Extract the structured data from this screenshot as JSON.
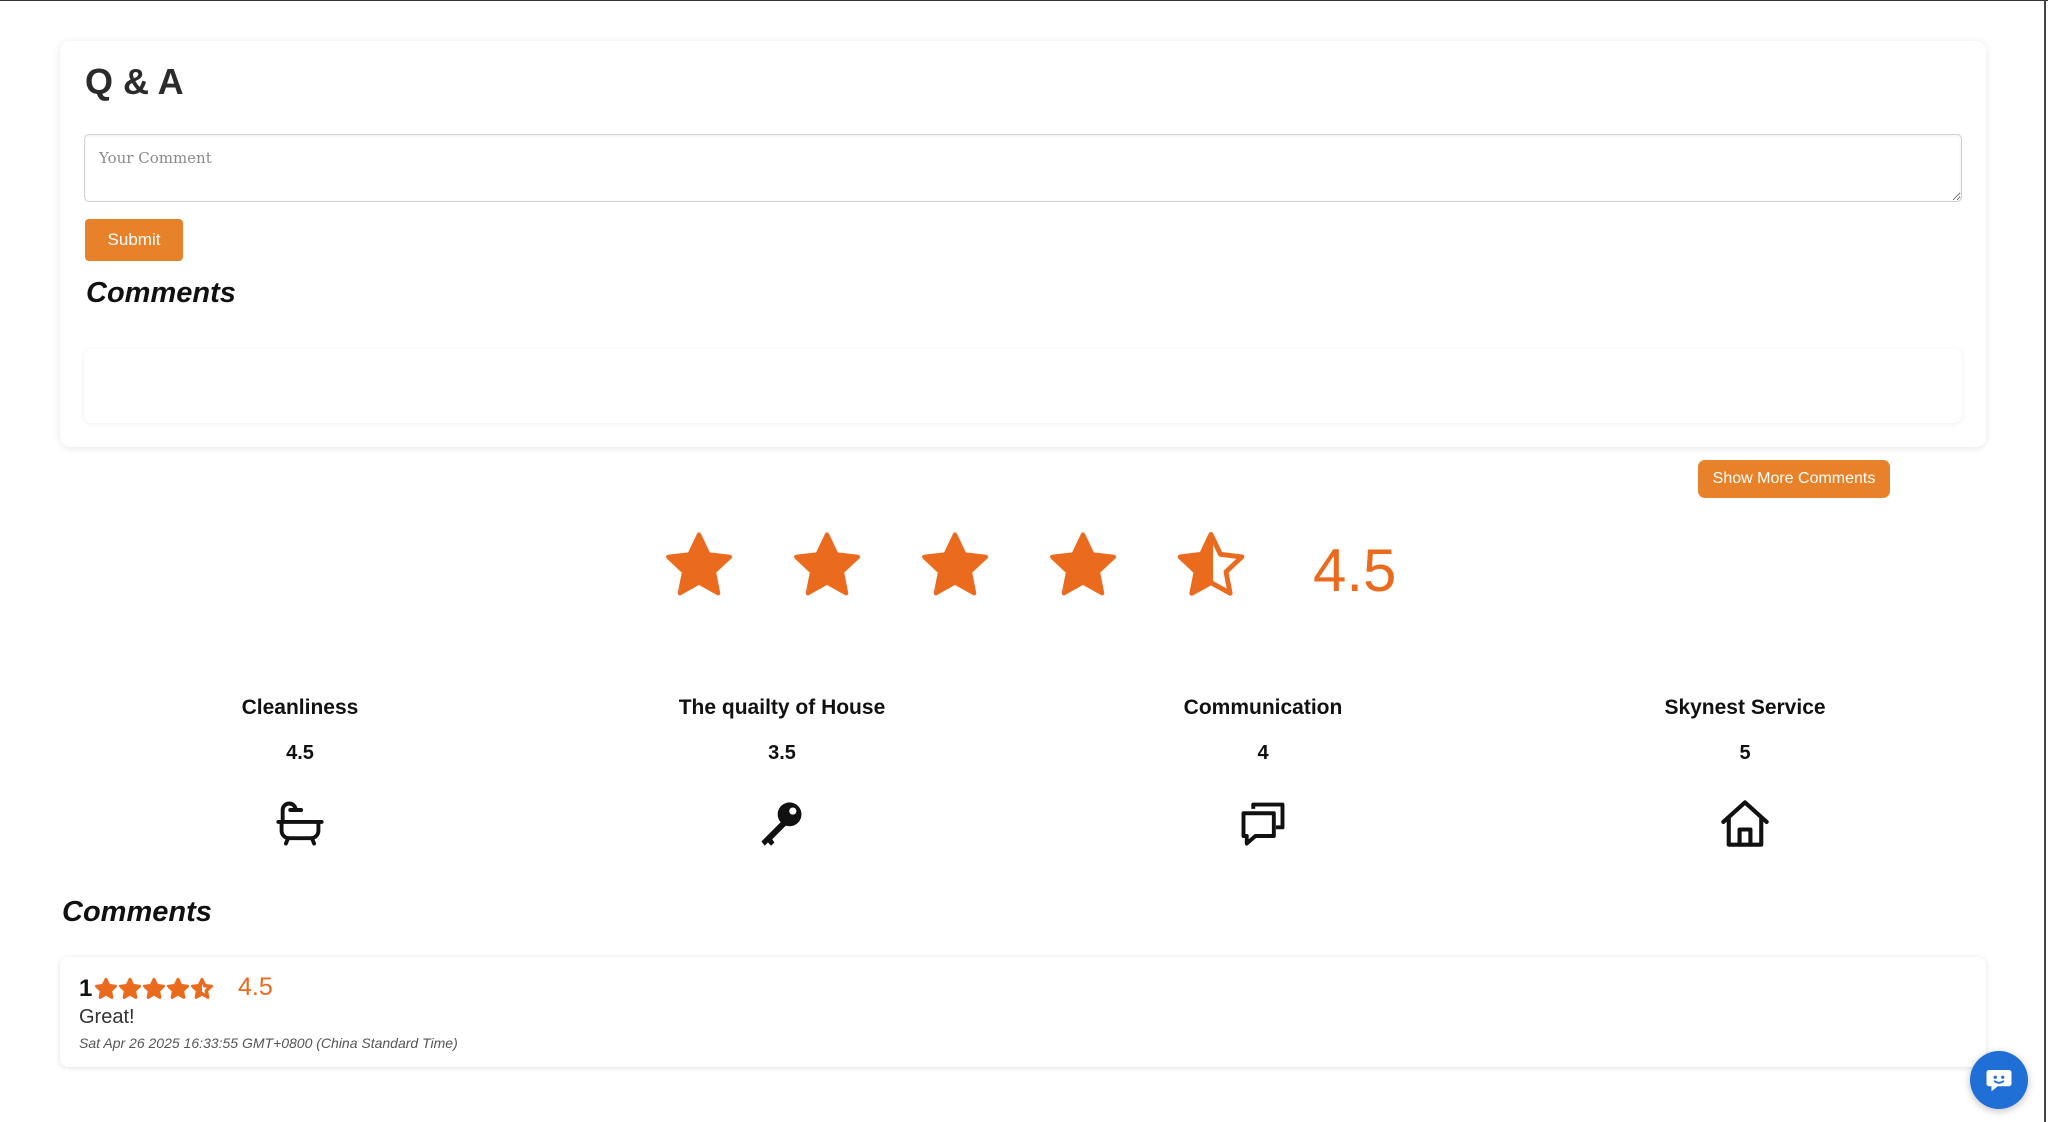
{
  "qa": {
    "title": "Q & A",
    "comment_placeholder": "Your Comment",
    "comment_value": "",
    "submit_label": "Submit",
    "comments_title": "Comments"
  },
  "show_more_label": "Show More Comments",
  "overall_rating": {
    "value": "4.5",
    "stars": 4.5,
    "max_stars": 5
  },
  "categories": [
    {
      "label": "Cleanliness",
      "value": "4.5",
      "icon": "bathtub-icon"
    },
    {
      "label": "The quailty of House",
      "value": "3.5",
      "icon": "key-icon"
    },
    {
      "label": "Communication",
      "value": "4",
      "icon": "chat-bubbles-icon"
    },
    {
      "label": "Skynest Service",
      "value": "5",
      "icon": "house-icon"
    }
  ],
  "comments": {
    "title": "Comments",
    "items": [
      {
        "number": "1",
        "stars": 4.5,
        "rating": "4.5",
        "text": "Great!",
        "date": "Sat Apr 26 2025 16:33:55 GMT+0800 (China Standard Time)"
      }
    ]
  },
  "colors": {
    "accent_orange": "#e8822a",
    "star_orange": "#ea6a1e",
    "chat_blue": "#1f6fd6"
  }
}
